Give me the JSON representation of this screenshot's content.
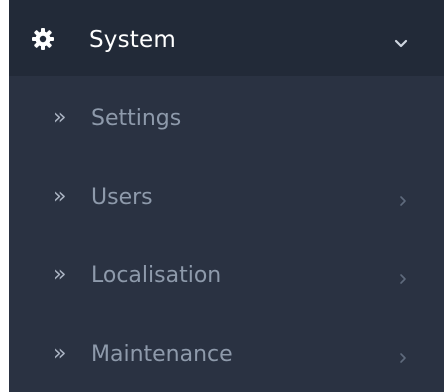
{
  "menu": {
    "section_title": "System",
    "section_icon": "gear-icon",
    "expand_icon": "chevron-down-icon",
    "items": [
      {
        "label": "Settings",
        "bullet": "»",
        "has_submenu": false
      },
      {
        "label": "Users",
        "bullet": "»",
        "has_submenu": true
      },
      {
        "label": "Localisation",
        "bullet": "»",
        "has_submenu": true
      },
      {
        "label": "Maintenance",
        "bullet": "»",
        "has_submenu": true
      }
    ]
  },
  "colors": {
    "header_bg": "#222a38",
    "menu_bg": "#2a3242",
    "title_text": "#ffffff",
    "item_text": "#8e9aab"
  }
}
